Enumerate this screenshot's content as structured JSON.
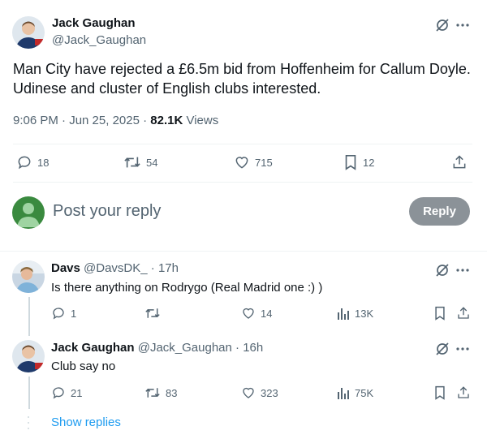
{
  "main_tweet": {
    "author_name": "Jack Gaughan",
    "author_handle": "@Jack_Gaughan",
    "text": "Man City have rejected a £6.5m bid from Hoffenheim for Callum Doyle. Udinese and cluster of English clubs interested.",
    "time": "9:06 PM · Jun 25, 2025 · ",
    "views_count": "82.1K",
    "views_label": " Views",
    "replies": "18",
    "reposts": "54",
    "likes": "715",
    "bookmarks": "12"
  },
  "composer": {
    "placeholder": "Post your reply",
    "reply_button": "Reply"
  },
  "replies": [
    {
      "author_name": "Davs",
      "author_handle": "@DavsDK_",
      "time": " · 17h",
      "text": "Is there anything on Rodrygo (Real Madrid one :) )",
      "replies": "1",
      "reposts": "",
      "likes": "14",
      "views": "13K"
    },
    {
      "author_name": "Jack Gaughan",
      "author_handle": "@Jack_Gaughan",
      "time": " · 16h",
      "text": "Club say no",
      "replies": "21",
      "reposts": "83",
      "likes": "323",
      "views": "75K"
    }
  ],
  "show_replies": "Show replies",
  "colors": {
    "accent": "#1d9bf0",
    "muted": "#536471",
    "reply_button_bg": "#8b9298",
    "divider": "#eff3f4"
  },
  "icons": [
    "grok-icon",
    "more-icon",
    "reply-icon",
    "repost-icon",
    "like-icon",
    "bookmark-icon",
    "share-icon",
    "views-icon"
  ]
}
